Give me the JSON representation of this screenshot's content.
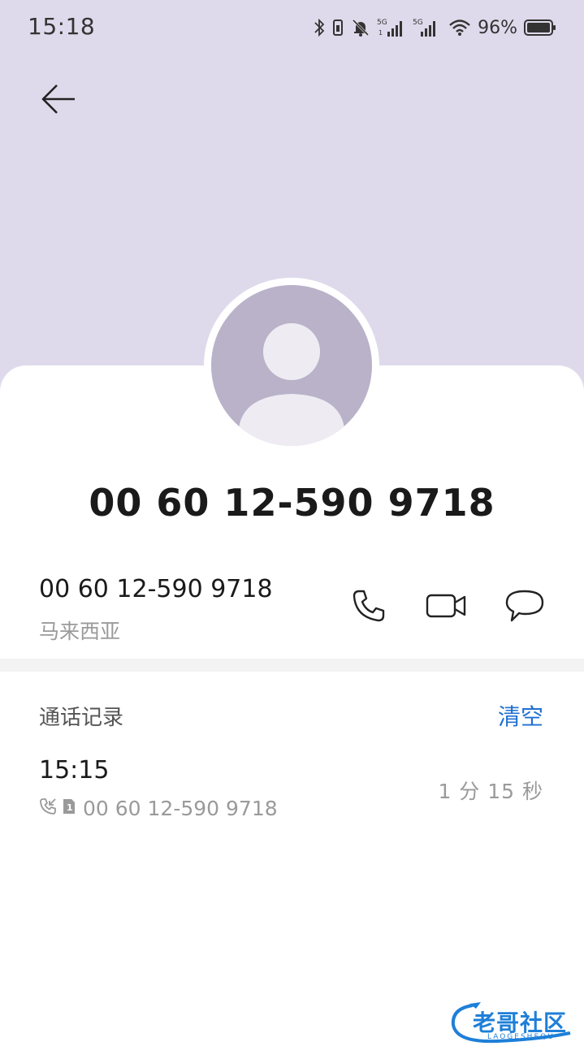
{
  "status_bar": {
    "time": "15:18",
    "battery": "96%",
    "icons": [
      "bluetooth-icon",
      "vibrate-icon",
      "mute-bell-icon",
      "5g-signal-icon",
      "5g-signal-icon",
      "wifi-icon",
      "battery-icon"
    ]
  },
  "header": {
    "back_icon": "arrow-left-icon"
  },
  "contact": {
    "display_number": "00 60 12-590 9718",
    "number": "00 60 12-590 9718",
    "location": "马来西亚"
  },
  "actions": [
    "phone-icon",
    "video-call-icon",
    "message-icon"
  ],
  "call_log": {
    "title": "通话记录",
    "clear_label": "清空",
    "entries": [
      {
        "time": "15:15",
        "number": "00 60 12-590 9718",
        "duration": "1 分 15 秒",
        "sim": "1"
      }
    ]
  },
  "watermark": {
    "text": "老哥社区",
    "sub": "LAOGESHEQU"
  },
  "colors": {
    "header_bg": "#dedaeb",
    "accent": "#1f6fd1",
    "avatar": "#b9b2c9"
  }
}
